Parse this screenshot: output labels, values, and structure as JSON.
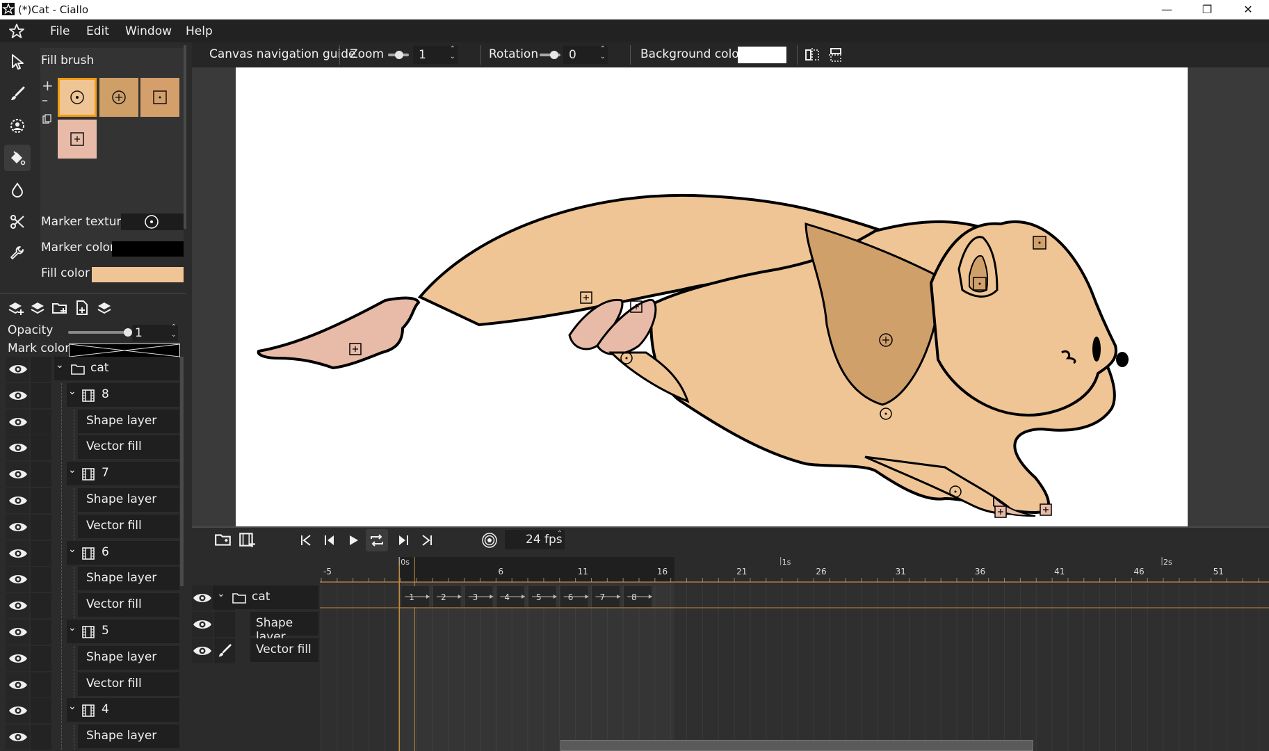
{
  "window": {
    "title": "(*)Cat - Ciallo",
    "minimize": "—",
    "restore": "❐",
    "close": "✕"
  },
  "menu": [
    "File",
    "Edit",
    "Window",
    "Help"
  ],
  "brush_panel": {
    "title": "Fill brush",
    "marker_texture_label": "Marker texture",
    "marker_color_label": "Marker color",
    "marker_color": "#000000",
    "fill_color_label": "Fill color",
    "fill_color": "#efc595"
  },
  "layer_tools": {
    "opacity_label": "Opacity",
    "opacity_value": "1",
    "mark_color_label": "Mark color"
  },
  "layers": [
    {
      "name": "cat",
      "type": "folder",
      "indent": 0
    },
    {
      "name": "8",
      "type": "film",
      "indent": 1
    },
    {
      "name": "Shape layer",
      "type": "layer",
      "indent": 2
    },
    {
      "name": "Vector fill",
      "type": "layer",
      "indent": 2
    },
    {
      "name": "7",
      "type": "film",
      "indent": 1
    },
    {
      "name": "Shape layer",
      "type": "layer",
      "indent": 2
    },
    {
      "name": "Vector fill",
      "type": "layer",
      "indent": 2
    },
    {
      "name": "6",
      "type": "film",
      "indent": 1
    },
    {
      "name": "Shape layer",
      "type": "layer",
      "indent": 2
    },
    {
      "name": "Vector fill",
      "type": "layer",
      "indent": 2
    },
    {
      "name": "5",
      "type": "film",
      "indent": 1
    },
    {
      "name": "Shape layer",
      "type": "layer",
      "indent": 2
    },
    {
      "name": "Vector fill",
      "type": "layer",
      "indent": 2
    },
    {
      "name": "4",
      "type": "film",
      "indent": 1
    },
    {
      "name": "Shape layer",
      "type": "layer",
      "indent": 2
    }
  ],
  "navbar": {
    "guide_label": "Canvas navigation guide",
    "zoom_label": "Zoom",
    "zoom_value": "1",
    "rotation_label": "Rotation",
    "rotation_value": "0",
    "bg_label": "Background color",
    "bg_color": "#ffffff"
  },
  "timeline": {
    "fps": "24 fps",
    "ruler_numbers": [
      "-5",
      "6",
      "11",
      "16",
      "21",
      "26",
      "31",
      "36",
      "41",
      "46",
      "51"
    ],
    "time_markers": [
      "0s",
      "1s",
      "2s"
    ],
    "keyframes": [
      "1",
      "2",
      "3",
      "4",
      "5",
      "6",
      "7",
      "8"
    ],
    "tracks": [
      {
        "name": "cat",
        "icon": "folder-icon"
      },
      {
        "name": "Shape layer",
        "icon": ""
      },
      {
        "name": "Vector fill",
        "icon": "brush-icon"
      }
    ]
  }
}
